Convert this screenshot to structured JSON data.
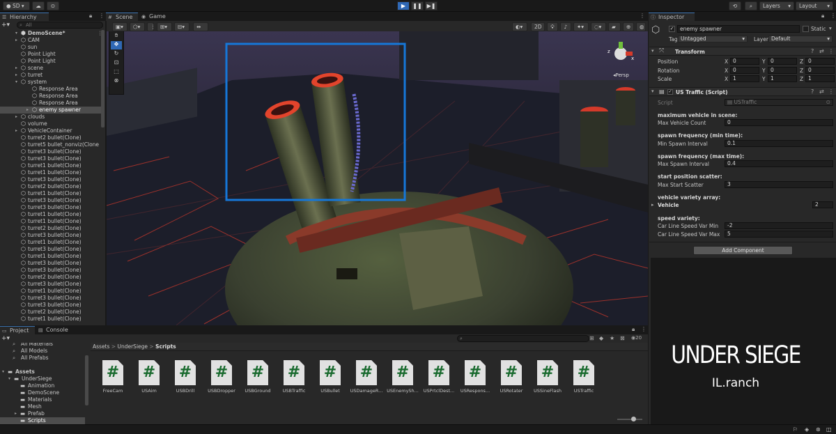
{
  "toolbar": {
    "account": "SD ▾",
    "layers": "Layers",
    "layout": "Layout"
  },
  "hierarchy": {
    "tab": "Hierarchy",
    "search_placeholder": "All",
    "scene_name": "DemoScene*",
    "items": [
      {
        "label": "CAM",
        "depth": 1,
        "arrow": "▸"
      },
      {
        "label": "sun",
        "depth": 1,
        "arrow": ""
      },
      {
        "label": "Point Light",
        "depth": 1,
        "arrow": ""
      },
      {
        "label": "Point Light",
        "depth": 1,
        "arrow": ""
      },
      {
        "label": "scene",
        "depth": 1,
        "arrow": "▸"
      },
      {
        "label": "turret",
        "depth": 1,
        "arrow": "▸"
      },
      {
        "label": "system",
        "depth": 1,
        "arrow": "▾"
      },
      {
        "label": "Response Area",
        "depth": 2,
        "arrow": ""
      },
      {
        "label": "Response Area",
        "depth": 2,
        "arrow": ""
      },
      {
        "label": "Response Area",
        "depth": 2,
        "arrow": ""
      },
      {
        "label": "enemy spawner",
        "depth": 2,
        "arrow": "▸",
        "selected": true
      },
      {
        "label": "clouds",
        "depth": 1,
        "arrow": "▸"
      },
      {
        "label": "volume",
        "depth": 1,
        "arrow": ""
      },
      {
        "label": "VehicleContainer",
        "depth": 1,
        "arrow": "▸"
      },
      {
        "label": "turret2 bullet(Clone)",
        "depth": 1,
        "arrow": ""
      },
      {
        "label": "turret5 bullet_nonviz(Clone",
        "depth": 1,
        "arrow": ""
      },
      {
        "label": "turret3 bullet(Clone)",
        "depth": 1,
        "arrow": ""
      },
      {
        "label": "turret3 bullet(Clone)",
        "depth": 1,
        "arrow": ""
      },
      {
        "label": "turret1 bullet(Clone)",
        "depth": 1,
        "arrow": ""
      },
      {
        "label": "turret1 bullet(Clone)",
        "depth": 1,
        "arrow": ""
      },
      {
        "label": "turret3 bullet(Clone)",
        "depth": 1,
        "arrow": ""
      },
      {
        "label": "turret2 bullet(Clone)",
        "depth": 1,
        "arrow": ""
      },
      {
        "label": "turret1 bullet(Clone)",
        "depth": 1,
        "arrow": ""
      },
      {
        "label": "turret3 bullet(Clone)",
        "depth": 1,
        "arrow": ""
      },
      {
        "label": "turret3 bullet(Clone)",
        "depth": 1,
        "arrow": ""
      },
      {
        "label": "turret1 bullet(Clone)",
        "depth": 1,
        "arrow": ""
      },
      {
        "label": "turret1 bullet(Clone)",
        "depth": 1,
        "arrow": ""
      },
      {
        "label": "turret2 bullet(Clone)",
        "depth": 1,
        "arrow": ""
      },
      {
        "label": "turret3 bullet(Clone)",
        "depth": 1,
        "arrow": ""
      },
      {
        "label": "turret1 bullet(Clone)",
        "depth": 1,
        "arrow": ""
      },
      {
        "label": "turret3 bullet(Clone)",
        "depth": 1,
        "arrow": ""
      },
      {
        "label": "turret1 bullet(Clone)",
        "depth": 1,
        "arrow": ""
      },
      {
        "label": "turret3 bullet(Clone)",
        "depth": 1,
        "arrow": ""
      },
      {
        "label": "turret3 bullet(Clone)",
        "depth": 1,
        "arrow": ""
      },
      {
        "label": "turret2 bullet(Clone)",
        "depth": 1,
        "arrow": ""
      },
      {
        "label": "turret3 bullet(Clone)",
        "depth": 1,
        "arrow": ""
      },
      {
        "label": "turret1 bullet(Clone)",
        "depth": 1,
        "arrow": ""
      },
      {
        "label": "turret3 bullet(Clone)",
        "depth": 1,
        "arrow": ""
      },
      {
        "label": "turret3 bullet(Clone)",
        "depth": 1,
        "arrow": ""
      },
      {
        "label": "turret2 bullet(Clone)",
        "depth": 1,
        "arrow": ""
      },
      {
        "label": "turret1 bullet(Clone)",
        "depth": 1,
        "arrow": ""
      }
    ]
  },
  "scene_view": {
    "tab_scene": "Scene",
    "tab_game": "Game",
    "mode_2d": "2D",
    "gizmo_label": "Persp",
    "gizmo_z": "z",
    "gizmo_x": "x"
  },
  "inspector": {
    "tab": "Inspector",
    "object_name": "enemy spawner",
    "static_label": "Static",
    "tag_label": "Tag",
    "tag_value": "Untagged",
    "layer_label": "Layer",
    "layer_value": "Default",
    "transform": {
      "title": "Transform",
      "position_label": "Position",
      "rotation_label": "Rotation",
      "scale_label": "Scale",
      "axis_x": "X",
      "axis_y": "Y",
      "axis_z": "Z",
      "position": [
        "0",
        "0",
        "0"
      ],
      "rotation": [
        "0",
        "0",
        "0"
      ],
      "scale": [
        "1",
        "1",
        "1"
      ]
    },
    "script_component": {
      "title": "US Traffic (Script)",
      "script_label": "Script",
      "script_value": "USTraffic",
      "h_max_vehicle": "maximum vehicle in scene:",
      "max_vehicle_label": "Max Vehicle Count",
      "max_vehicle_value": "0",
      "h_spawn_min": "spawn frequency (min time):",
      "min_spawn_label": "Min Spawn Interval",
      "min_spawn_value": "0.1",
      "h_spawn_max": "spawn frequency (max time):",
      "max_spawn_label": "Max Spawn Interval",
      "max_spawn_value": "0.4",
      "h_scatter": "start position scatter:",
      "scatter_label": "Max Start Scatter",
      "scatter_value": "3",
      "h_variety": "vehicle variety array:",
      "vehicle_label": "Vehicle",
      "vehicle_value": "2",
      "h_speed": "speed variety:",
      "speed_min_label": "Car Line Speed Var Min",
      "speed_min_value": "-2",
      "speed_max_label": "Car Line Speed Var Max",
      "speed_max_value": "5"
    },
    "add_component": "Add Component"
  },
  "project": {
    "tab_project": "Project",
    "tab_console": "Console",
    "favorites": [
      "All Materials",
      "All Models",
      "All Prefabs"
    ],
    "assets_root": "Assets",
    "folders": [
      {
        "label": "UnderSiege",
        "depth": 1,
        "arrow": "▾"
      },
      {
        "label": "Animation",
        "depth": 2,
        "arrow": ""
      },
      {
        "label": "DemoScene",
        "depth": 2,
        "arrow": ""
      },
      {
        "label": "Materials",
        "depth": 2,
        "arrow": ""
      },
      {
        "label": "Mesh",
        "depth": 2,
        "arrow": ""
      },
      {
        "label": "Prefab",
        "depth": 2,
        "arrow": "▸"
      },
      {
        "label": "Scripts",
        "depth": 2,
        "arrow": "",
        "selected": true
      }
    ],
    "breadcrumb": [
      "Assets",
      "UnderSiege",
      "Scripts"
    ],
    "hidden_count": "20",
    "assets": [
      "FreeCam",
      "USAim",
      "USBDrill",
      "USBDropper",
      "USBGround",
      "USBTraffic",
      "USBullet",
      "USDamageR...",
      "USEnemySh...",
      "USPrtclDest...",
      "USRespons...",
      "USRotater",
      "USSineFlash",
      "USTraffic"
    ]
  },
  "branding": {
    "title": "UNDER SIEGE",
    "subtitle": "IL.ranch"
  },
  "colors": {
    "accent": "#2f68b5",
    "selection_box": "#1677d8",
    "script_hash": "#196a2e",
    "panel_bg": "#282828"
  }
}
